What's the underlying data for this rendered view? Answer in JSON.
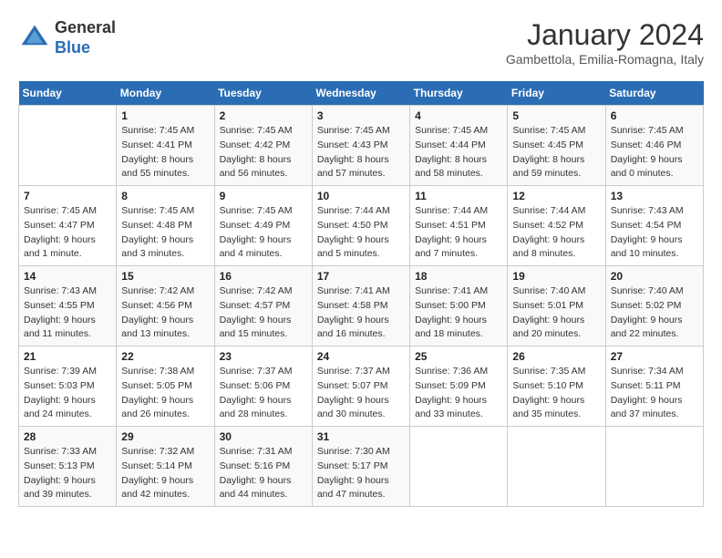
{
  "header": {
    "logo": {
      "general": "General",
      "blue": "Blue"
    },
    "title": "January 2024",
    "subtitle": "Gambettola, Emilia-Romagna, Italy"
  },
  "weekdays": [
    "Sunday",
    "Monday",
    "Tuesday",
    "Wednesday",
    "Thursday",
    "Friday",
    "Saturday"
  ],
  "weeks": [
    [
      {
        "day": "",
        "info": ""
      },
      {
        "day": "1",
        "info": "Sunrise: 7:45 AM\nSunset: 4:41 PM\nDaylight: 8 hours\nand 55 minutes."
      },
      {
        "day": "2",
        "info": "Sunrise: 7:45 AM\nSunset: 4:42 PM\nDaylight: 8 hours\nand 56 minutes."
      },
      {
        "day": "3",
        "info": "Sunrise: 7:45 AM\nSunset: 4:43 PM\nDaylight: 8 hours\nand 57 minutes."
      },
      {
        "day": "4",
        "info": "Sunrise: 7:45 AM\nSunset: 4:44 PM\nDaylight: 8 hours\nand 58 minutes."
      },
      {
        "day": "5",
        "info": "Sunrise: 7:45 AM\nSunset: 4:45 PM\nDaylight: 8 hours\nand 59 minutes."
      },
      {
        "day": "6",
        "info": "Sunrise: 7:45 AM\nSunset: 4:46 PM\nDaylight: 9 hours\nand 0 minutes."
      }
    ],
    [
      {
        "day": "7",
        "info": "Sunrise: 7:45 AM\nSunset: 4:47 PM\nDaylight: 9 hours\nand 1 minute."
      },
      {
        "day": "8",
        "info": "Sunrise: 7:45 AM\nSunset: 4:48 PM\nDaylight: 9 hours\nand 3 minutes."
      },
      {
        "day": "9",
        "info": "Sunrise: 7:45 AM\nSunset: 4:49 PM\nDaylight: 9 hours\nand 4 minutes."
      },
      {
        "day": "10",
        "info": "Sunrise: 7:44 AM\nSunset: 4:50 PM\nDaylight: 9 hours\nand 5 minutes."
      },
      {
        "day": "11",
        "info": "Sunrise: 7:44 AM\nSunset: 4:51 PM\nDaylight: 9 hours\nand 7 minutes."
      },
      {
        "day": "12",
        "info": "Sunrise: 7:44 AM\nSunset: 4:52 PM\nDaylight: 9 hours\nand 8 minutes."
      },
      {
        "day": "13",
        "info": "Sunrise: 7:43 AM\nSunset: 4:54 PM\nDaylight: 9 hours\nand 10 minutes."
      }
    ],
    [
      {
        "day": "14",
        "info": "Sunrise: 7:43 AM\nSunset: 4:55 PM\nDaylight: 9 hours\nand 11 minutes."
      },
      {
        "day": "15",
        "info": "Sunrise: 7:42 AM\nSunset: 4:56 PM\nDaylight: 9 hours\nand 13 minutes."
      },
      {
        "day": "16",
        "info": "Sunrise: 7:42 AM\nSunset: 4:57 PM\nDaylight: 9 hours\nand 15 minutes."
      },
      {
        "day": "17",
        "info": "Sunrise: 7:41 AM\nSunset: 4:58 PM\nDaylight: 9 hours\nand 16 minutes."
      },
      {
        "day": "18",
        "info": "Sunrise: 7:41 AM\nSunset: 5:00 PM\nDaylight: 9 hours\nand 18 minutes."
      },
      {
        "day": "19",
        "info": "Sunrise: 7:40 AM\nSunset: 5:01 PM\nDaylight: 9 hours\nand 20 minutes."
      },
      {
        "day": "20",
        "info": "Sunrise: 7:40 AM\nSunset: 5:02 PM\nDaylight: 9 hours\nand 22 minutes."
      }
    ],
    [
      {
        "day": "21",
        "info": "Sunrise: 7:39 AM\nSunset: 5:03 PM\nDaylight: 9 hours\nand 24 minutes."
      },
      {
        "day": "22",
        "info": "Sunrise: 7:38 AM\nSunset: 5:05 PM\nDaylight: 9 hours\nand 26 minutes."
      },
      {
        "day": "23",
        "info": "Sunrise: 7:37 AM\nSunset: 5:06 PM\nDaylight: 9 hours\nand 28 minutes."
      },
      {
        "day": "24",
        "info": "Sunrise: 7:37 AM\nSunset: 5:07 PM\nDaylight: 9 hours\nand 30 minutes."
      },
      {
        "day": "25",
        "info": "Sunrise: 7:36 AM\nSunset: 5:09 PM\nDaylight: 9 hours\nand 33 minutes."
      },
      {
        "day": "26",
        "info": "Sunrise: 7:35 AM\nSunset: 5:10 PM\nDaylight: 9 hours\nand 35 minutes."
      },
      {
        "day": "27",
        "info": "Sunrise: 7:34 AM\nSunset: 5:11 PM\nDaylight: 9 hours\nand 37 minutes."
      }
    ],
    [
      {
        "day": "28",
        "info": "Sunrise: 7:33 AM\nSunset: 5:13 PM\nDaylight: 9 hours\nand 39 minutes."
      },
      {
        "day": "29",
        "info": "Sunrise: 7:32 AM\nSunset: 5:14 PM\nDaylight: 9 hours\nand 42 minutes."
      },
      {
        "day": "30",
        "info": "Sunrise: 7:31 AM\nSunset: 5:16 PM\nDaylight: 9 hours\nand 44 minutes."
      },
      {
        "day": "31",
        "info": "Sunrise: 7:30 AM\nSunset: 5:17 PM\nDaylight: 9 hours\nand 47 minutes."
      },
      {
        "day": "",
        "info": ""
      },
      {
        "day": "",
        "info": ""
      },
      {
        "day": "",
        "info": ""
      }
    ]
  ]
}
